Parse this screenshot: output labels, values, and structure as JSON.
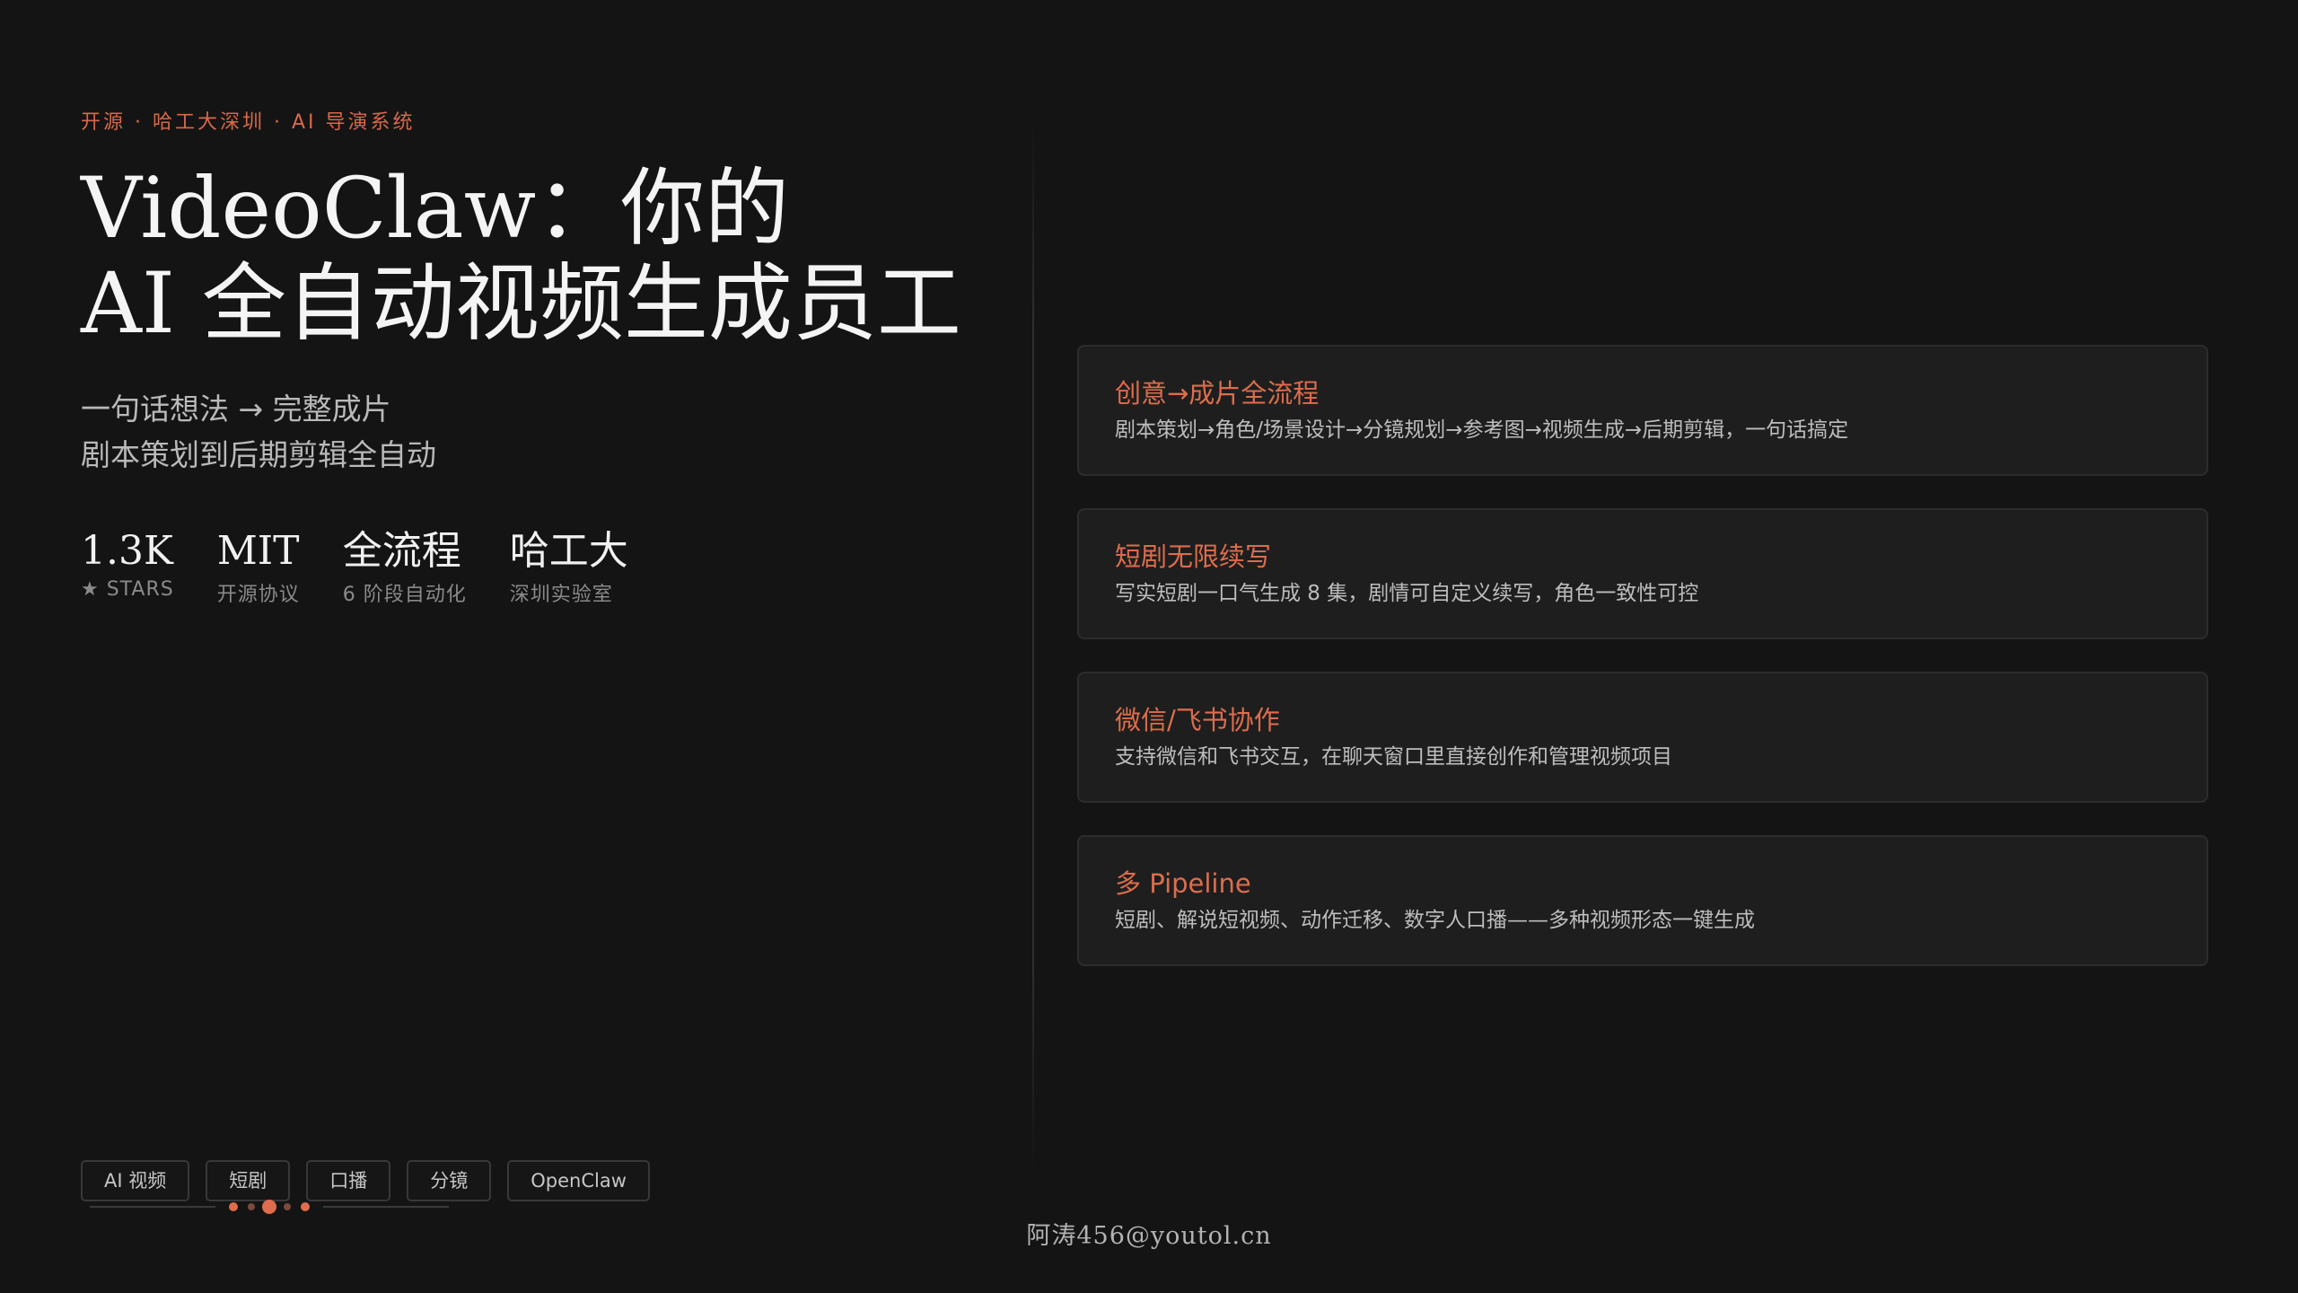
{
  "hero": {
    "eyebrow": "开源 · 哈工大深圳 · AI 导演系统",
    "title_line1": "VideoClaw：你的",
    "title_line2": "AI 全自动视频生成员工",
    "subtitle_line1": "一句话想法 → 完整成片",
    "subtitle_line2": "剧本策划到后期剪辑全自动"
  },
  "stats": [
    {
      "value": "1.3K",
      "label": "★ STARS"
    },
    {
      "value": "MIT",
      "label": "开源协议"
    },
    {
      "value": "全流程",
      "label": "6 阶段自动化"
    },
    {
      "value": "哈工大",
      "label": "深圳实验室"
    }
  ],
  "features": [
    {
      "title": "创意→成片全流程",
      "desc": "剧本策划→角色/场景设计→分镜规划→参考图→视频生成→后期剪辑，一句话搞定"
    },
    {
      "title": "短剧无限续写",
      "desc": "写实短剧一口气生成 8 集，剧情可自定义续写，角色一致性可控"
    },
    {
      "title": "微信/飞书协作",
      "desc": "支持微信和飞书交互，在聊天窗口里直接创作和管理视频项目"
    },
    {
      "title": "多 Pipeline",
      "desc": "短剧、解说短视频、动作迁移、数字人口播——多种视频形态一键生成"
    }
  ],
  "tags": [
    "AI 视频",
    "短剧",
    "口播",
    "分镜",
    "OpenClaw"
  ],
  "footer": {
    "text": "阿涛456@youtol.cn"
  },
  "colors": {
    "accent": "#dd6d4c",
    "background": "#141414",
    "card": "#1e1e1e"
  }
}
